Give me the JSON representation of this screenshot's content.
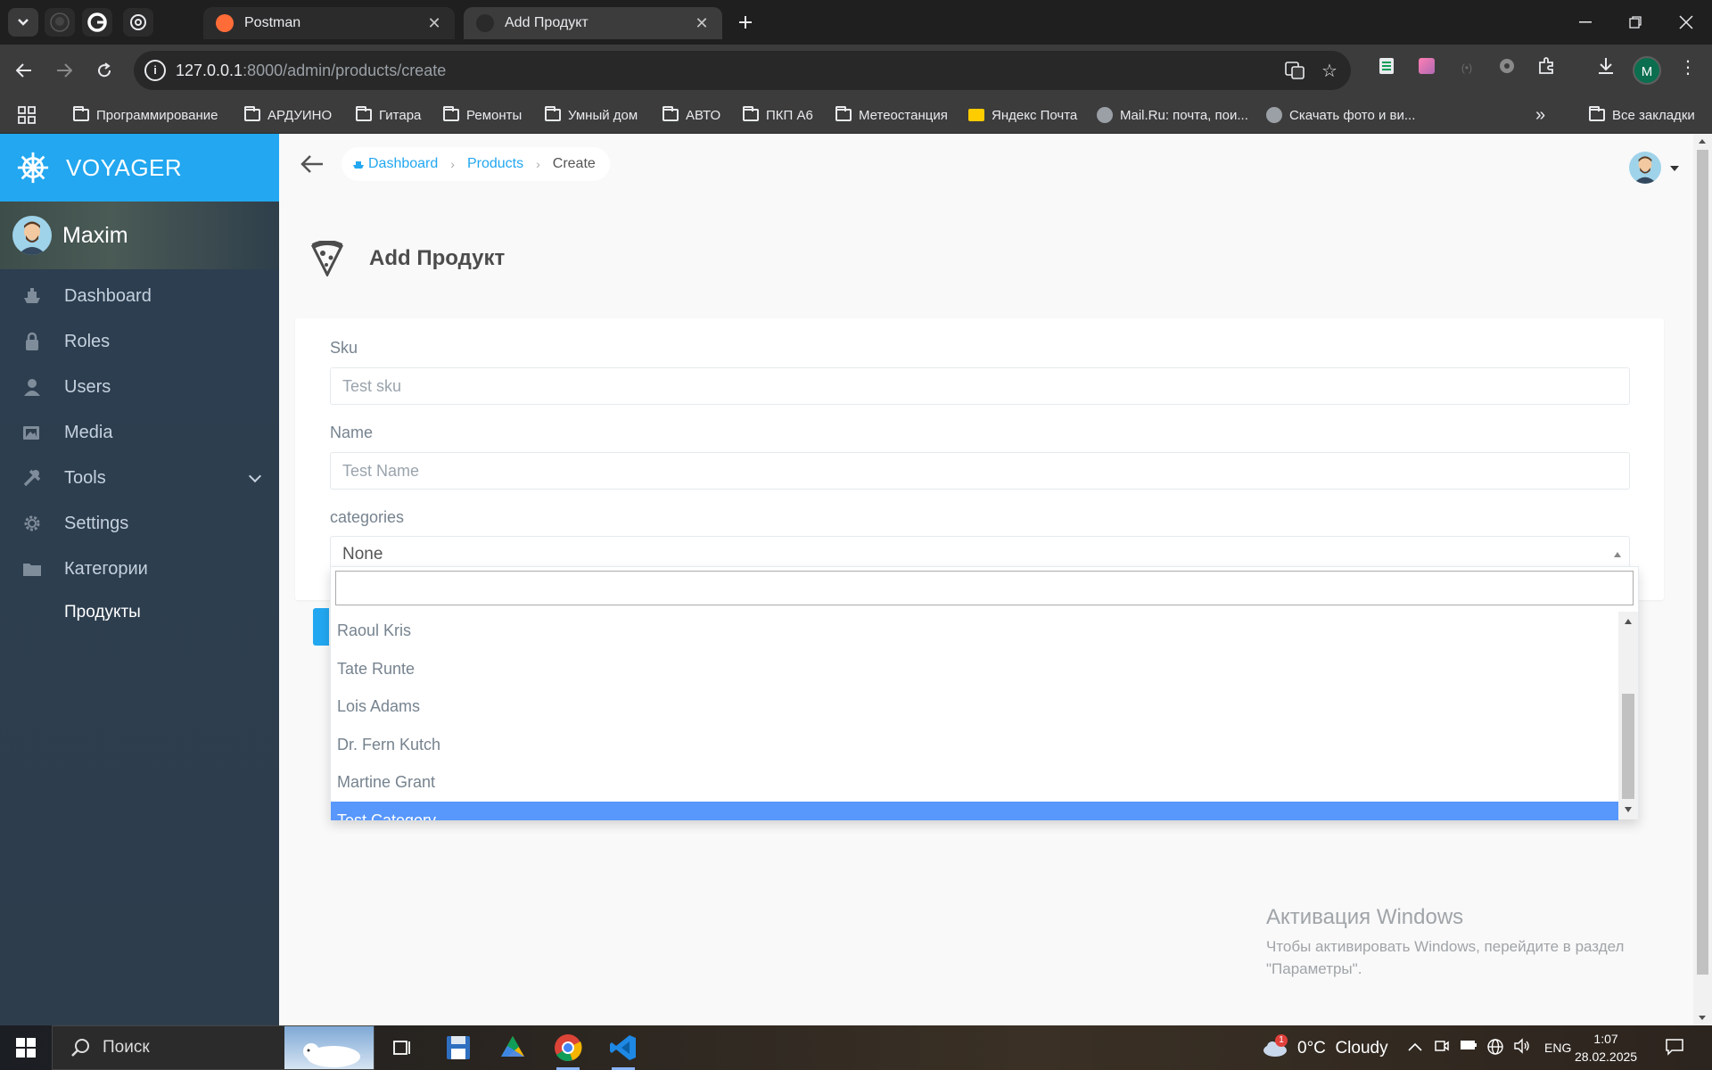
{
  "browser": {
    "tabs": [
      {
        "title": "Postman",
        "active": false
      },
      {
        "title": "Add Продукт",
        "active": true
      }
    ],
    "url_host": "127.0.0.1",
    "url_path": ":8000/admin/products/create",
    "bookmarks": [
      {
        "label": "Программирование",
        "type": "folder"
      },
      {
        "label": "АРДУИНО",
        "type": "folder"
      },
      {
        "label": "Гитара",
        "type": "folder"
      },
      {
        "label": "Ремонты",
        "type": "folder"
      },
      {
        "label": "Умный дом",
        "type": "folder"
      },
      {
        "label": "АВТО",
        "type": "folder"
      },
      {
        "label": "ПКП А6",
        "type": "folder"
      },
      {
        "label": "Метеостанция",
        "type": "folder"
      },
      {
        "label": "Яндекс Почта",
        "type": "site"
      },
      {
        "label": "Mail.Ru: почта, пои...",
        "type": "site"
      },
      {
        "label": "Скачать фото и ви...",
        "type": "site"
      }
    ],
    "all_bookmarks": "Все закладки",
    "profile_letter": "M"
  },
  "sidebar": {
    "brand": "VOYAGER",
    "user_name": "Maxim",
    "items": [
      {
        "label": "Dashboard",
        "icon": "boat-icon"
      },
      {
        "label": "Roles",
        "icon": "lock-icon"
      },
      {
        "label": "Users",
        "icon": "person-icon"
      },
      {
        "label": "Media",
        "icon": "images-icon"
      },
      {
        "label": "Tools",
        "icon": "tools-icon"
      },
      {
        "label": "Settings",
        "icon": "gear-icon"
      },
      {
        "label": "Категории",
        "icon": "folder-icon"
      },
      {
        "label": "Продукты",
        "icon": "none"
      }
    ]
  },
  "breadcrumb": {
    "dashboard": "Dashboard",
    "products": "Products",
    "current": "Create"
  },
  "page": {
    "title": "Add Продукт"
  },
  "form": {
    "sku_label": "Sku",
    "sku_placeholder": "Test sku",
    "name_label": "Name",
    "name_placeholder": "Test Name",
    "categories_label": "categories",
    "categories_selected": "None"
  },
  "dropdown": {
    "options": [
      "Raoul Kris",
      "Tate Runte",
      "Lois Adams",
      "Dr. Fern Kutch",
      "Martine Grant",
      "Test Category"
    ],
    "highlighted": "Test Category"
  },
  "activation": {
    "title": "Активация Windows",
    "text": "Чтобы активировать Windows, перейдите в раздел \"Параметры\"."
  },
  "taskbar": {
    "search_text": "Поиск",
    "weather": "0°C  Cloudy",
    "weather_badge": "1",
    "lang": "ENG",
    "time": "1:07",
    "date": "28.02.2025"
  },
  "colors": {
    "accent": "#22a7f0",
    "sidebar": "#2c3e50",
    "highlight": "#5897fb"
  }
}
